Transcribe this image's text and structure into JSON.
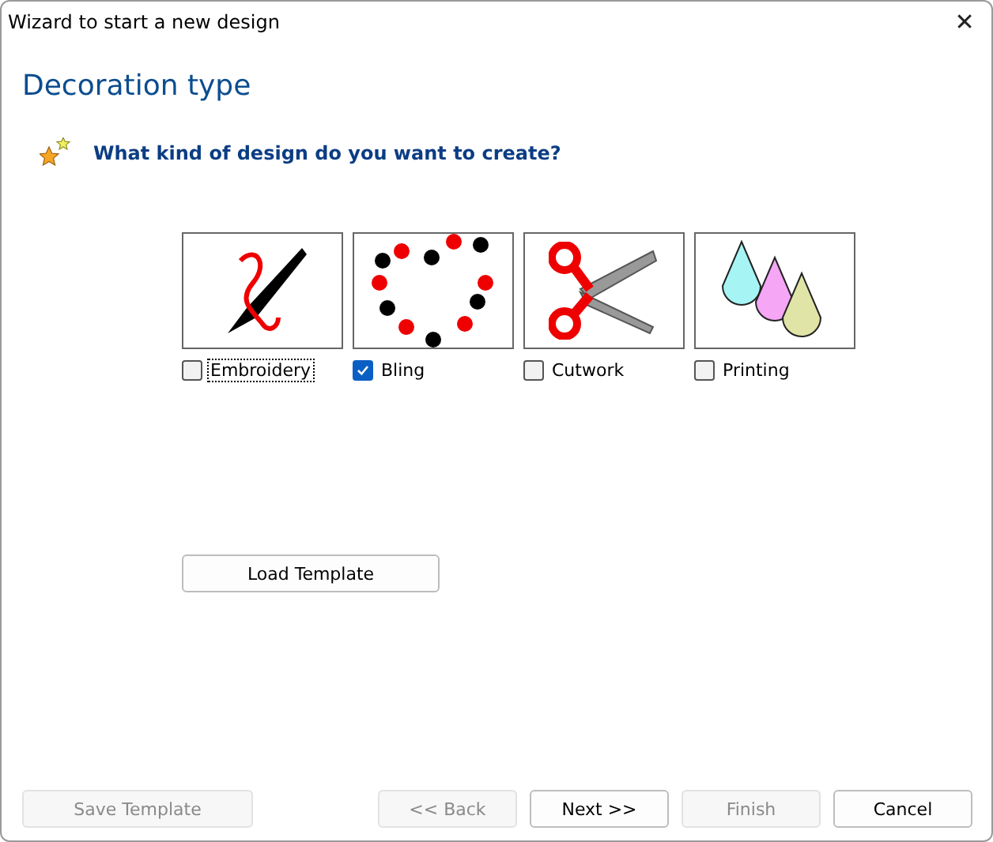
{
  "window": {
    "title": "Wizard to start a new design",
    "close": "✕"
  },
  "heading": "Decoration type",
  "question": "What kind of design do you want to create?",
  "options": [
    {
      "kind": "embroidery",
      "label": "Embroidery",
      "checked": false,
      "focused": true
    },
    {
      "kind": "bling",
      "label": "Bling",
      "checked": true,
      "focused": false
    },
    {
      "kind": "cutwork",
      "label": "Cutwork",
      "checked": false,
      "focused": false
    },
    {
      "kind": "printing",
      "label": "Printing",
      "checked": false,
      "focused": false
    }
  ],
  "load_button": {
    "label": "Load Template"
  },
  "buttons": [
    {
      "label": "Save Template",
      "disabled": true
    },
    {
      "label": "<< Back",
      "disabled": true
    },
    {
      "label": "Next >>",
      "disabled": false
    },
    {
      "label": "Finish",
      "disabled": true
    },
    {
      "label": "Cancel",
      "disabled": false
    }
  ]
}
